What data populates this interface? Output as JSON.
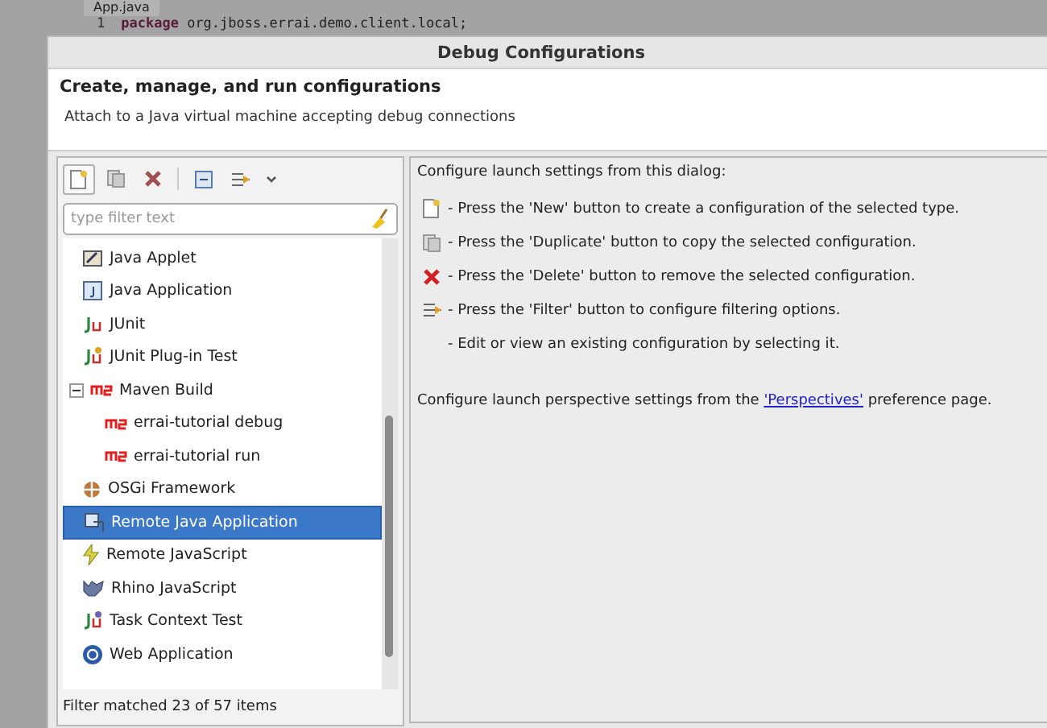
{
  "editor": {
    "tab": "App.java",
    "line_number": "1",
    "code_keyword": "package",
    "code_rest": " org.jboss.errai.demo.client.local;"
  },
  "dialog": {
    "title": "Debug Configurations",
    "heading": "Create, manage, and run configurations",
    "message": "Attach to a Java virtual machine accepting debug connections"
  },
  "toolbar": [
    {
      "kind": "new"
    },
    {
      "kind": "duplicate"
    },
    {
      "kind": "delete"
    },
    {
      "kind": "collapse"
    },
    {
      "kind": "filter"
    },
    {
      "kind": "menu"
    }
  ],
  "filter": {
    "placeholder": "type filter text"
  },
  "tree": [
    {
      "label": "Java Applet",
      "kind": "applet",
      "selected": false
    },
    {
      "label": "Java Application",
      "kind": "application",
      "selected": false
    },
    {
      "label": "JUnit",
      "kind": "junit",
      "selected": false
    },
    {
      "label": "JUnit Plug-in Test",
      "kind": "plugin-test",
      "selected": false
    },
    {
      "label": "Maven Build",
      "kind": "maven",
      "selected": false,
      "expanded": true,
      "children": [
        {
          "label": "errai-tutorial debug",
          "kind": "maven",
          "selected": false
        },
        {
          "label": "errai-tutorial run",
          "kind": "maven",
          "selected": false
        }
      ]
    },
    {
      "label": "OSGi Framework",
      "kind": "osgi",
      "selected": false
    },
    {
      "label": "Remote Java Application",
      "kind": "remote-java",
      "selected": true
    },
    {
      "label": "Remote JavaScript",
      "kind": "remote-js",
      "selected": false
    },
    {
      "label": "Rhino JavaScript",
      "kind": "rhino",
      "selected": false
    },
    {
      "label": "Task Context Test",
      "kind": "task-test",
      "selected": false
    },
    {
      "label": "Web Application",
      "kind": "web",
      "selected": false
    }
  ],
  "filter_status": "Filter matched 23 of 57 items",
  "help": {
    "intro": "Configure launch settings from this dialog:",
    "items": [
      {
        "kind": "new",
        "text": "- Press the 'New' button to create a configuration of the selected type."
      },
      {
        "kind": "duplicate",
        "text": "- Press the 'Duplicate' button to copy the selected configuration."
      },
      {
        "kind": "delete",
        "text": "- Press the 'Delete' button to remove the selected configuration."
      },
      {
        "kind": "filter",
        "text": "- Press the 'Filter' button to configure filtering options."
      },
      {
        "kind": "none",
        "text": "- Edit or view an existing configuration by selecting it."
      }
    ],
    "perspective_before": "Configure launch perspective settings from the ",
    "perspective_link": "'Perspectives'",
    "perspective_after": " preference page."
  }
}
